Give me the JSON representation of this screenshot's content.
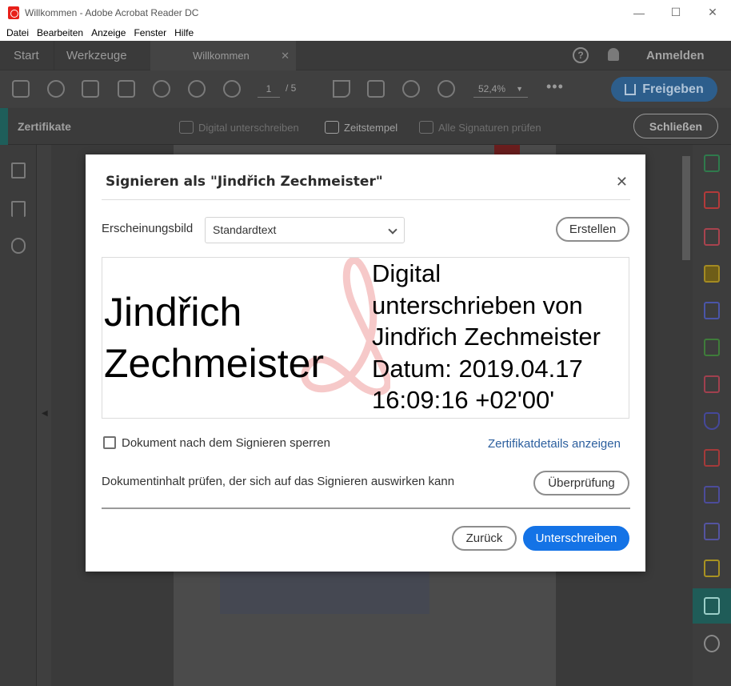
{
  "window": {
    "title": "Willkommen - Adobe Acrobat Reader DC",
    "minimize": "—",
    "maximize": "☐",
    "close": "✕"
  },
  "menu": [
    "Datei",
    "Bearbeiten",
    "Anzeige",
    "Fenster",
    "Hilfe"
  ],
  "tabs": {
    "start": "Start",
    "tools": "Werkzeuge",
    "document": "Willkommen",
    "close": "✕",
    "help": "?",
    "login": "Anmelden"
  },
  "toolbar": {
    "page_current": "1",
    "page_total": "/ 5",
    "zoom": "52,4%",
    "zoom_caret": "▼",
    "more": "•••",
    "share_label": "Freigeben"
  },
  "cert_toolbar": {
    "title": "Zertifikate",
    "sign": "Digital unterschreiben",
    "timestamp": "Zeitstempel",
    "verify": "Alle Signaturen prüfen",
    "close": "Schließen"
  },
  "dialog": {
    "title": "Signieren als \"Jindřich Zechmeister\"",
    "close": "✕",
    "appearance_label": "Erscheinungsbild",
    "appearance_value": "Standardtext",
    "create_button": "Erstellen",
    "preview_name": [
      "Jindřich",
      "Zechmeister"
    ],
    "preview_details": [
      "Digital",
      "unterschrieben von",
      "Jindřich Zechmeister",
      "Datum: 2019.04.17",
      "16:09:16 +02'00'"
    ],
    "lock_label": "Dokument nach dem Signieren sperren",
    "lock_checked": false,
    "cert_details_link": "Zertifikatdetails anzeigen",
    "review_text": "Dokumentinhalt prüfen, der sich auf das Signieren auswirken kann",
    "review_button": "Überprüfung",
    "back_button": "Zurück",
    "sign_button": "Unterschreiben"
  },
  "colors": {
    "primary_blue": "#1473e6",
    "link_blue": "#2c5f9e",
    "teal_accent": "#1e5e5a",
    "adobe_red": "#e8201a"
  }
}
